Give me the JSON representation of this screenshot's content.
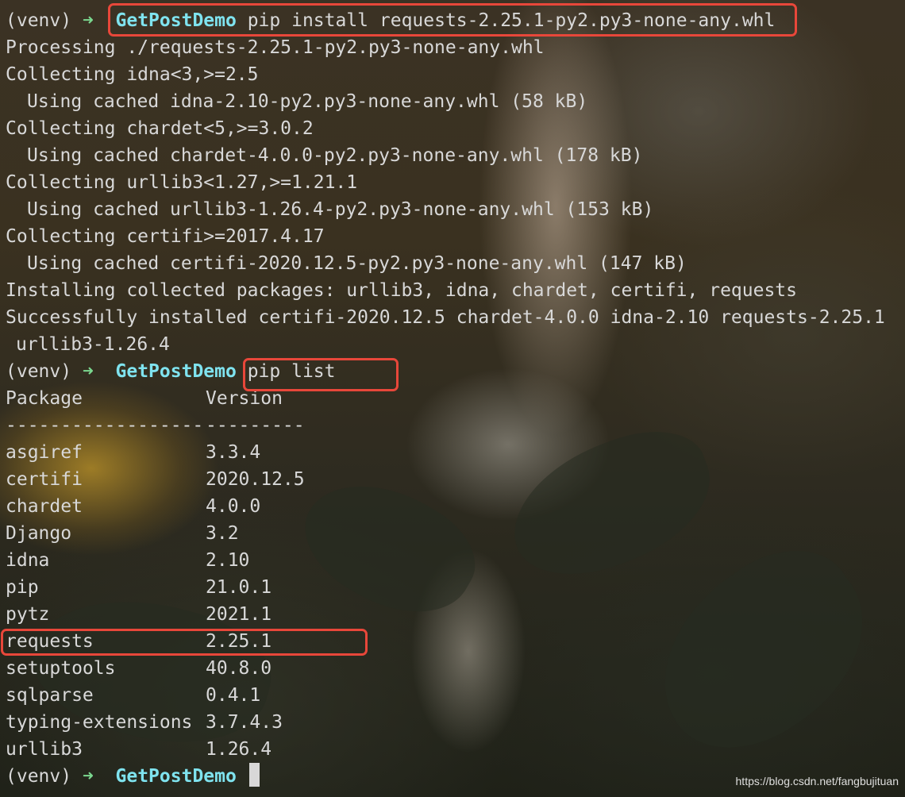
{
  "prompt": {
    "venv": "(venv)",
    "arrow": "➜",
    "dir": "GetPostDemo"
  },
  "commands": {
    "install": "pip install requests-2.25.1-py2.py3-none-any.whl",
    "list": "pip list"
  },
  "install_output": [
    {
      "text": "Processing ./requests-2.25.1-py2.py3-none-any.whl",
      "indent": false
    },
    {
      "text": "Collecting idna<3,>=2.5",
      "indent": false
    },
    {
      "text": "Using cached idna-2.10-py2.py3-none-any.whl (58 kB)",
      "indent": true
    },
    {
      "text": "Collecting chardet<5,>=3.0.2",
      "indent": false
    },
    {
      "text": "Using cached chardet-4.0.0-py2.py3-none-any.whl (178 kB)",
      "indent": true
    },
    {
      "text": "Collecting urllib3<1.27,>=1.21.1",
      "indent": false
    },
    {
      "text": "Using cached urllib3-1.26.4-py2.py3-none-any.whl (153 kB)",
      "indent": true
    },
    {
      "text": "Collecting certifi>=2017.4.17",
      "indent": false
    },
    {
      "text": "Using cached certifi-2020.12.5-py2.py3-none-any.whl (147 kB)",
      "indent": true
    },
    {
      "text": "Installing collected packages: urllib3, idna, chardet, certifi, requests",
      "indent": false
    },
    {
      "text": "Successfully installed certifi-2020.12.5 chardet-4.0.0 idna-2.10 requests-2.25.1",
      "indent": false
    }
  ],
  "install_output_wrap": "urllib3-1.26.4",
  "package_table": {
    "headers": {
      "package": "Package",
      "version": "Version"
    },
    "separator": {
      "package": "------------------",
      "version": "---------"
    },
    "rows": [
      {
        "package": "asgiref",
        "version": "3.3.4"
      },
      {
        "package": "certifi",
        "version": "2020.12.5"
      },
      {
        "package": "chardet",
        "version": "4.0.0"
      },
      {
        "package": "Django",
        "version": "3.2"
      },
      {
        "package": "idna",
        "version": "2.10"
      },
      {
        "package": "pip",
        "version": "21.0.1"
      },
      {
        "package": "pytz",
        "version": "2021.1"
      },
      {
        "package": "requests",
        "version": "2.25.1"
      },
      {
        "package": "setuptools",
        "version": "40.8.0"
      },
      {
        "package": "sqlparse",
        "version": "0.4.1"
      },
      {
        "package": "typing-extensions",
        "version": "3.7.4.3"
      },
      {
        "package": "urllib3",
        "version": "1.26.4"
      }
    ]
  },
  "watermark": "https://blog.csdn.net/fangbujituan",
  "colors": {
    "text": "#d8d8d8",
    "arrow": "#7bd88f",
    "directory": "#7fe3ef",
    "annotation": "#e8473a"
  }
}
